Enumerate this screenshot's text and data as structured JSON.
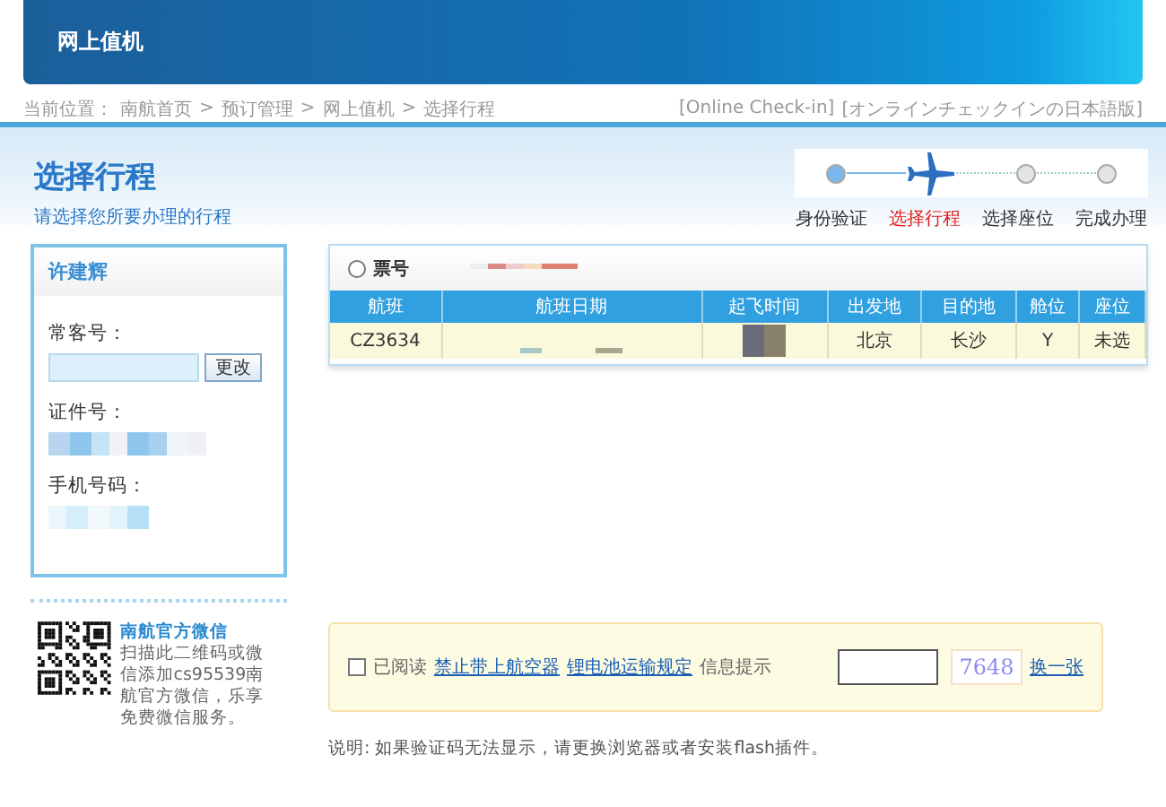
{
  "header": {
    "title": "网上值机"
  },
  "breadcrumb": {
    "label": "当前位置：",
    "separator": ">",
    "items": [
      "南航首页",
      "预订管理",
      "网上值机",
      "选择行程"
    ]
  },
  "language_links": [
    "[Online Check-in]",
    "[オンラインチェックインの日本語版]"
  ],
  "page": {
    "title": "选择行程",
    "subtitle": "请选择您所要办理的行程"
  },
  "steps": [
    {
      "label": "身份验证",
      "done": true,
      "selected": false
    },
    {
      "label": "选择行程",
      "done": false,
      "selected": true
    },
    {
      "label": "选择座位",
      "done": false,
      "selected": false
    },
    {
      "label": "完成办理",
      "done": false,
      "selected": false
    }
  ],
  "passenger": {
    "name": "许建辉",
    "fields": [
      {
        "kind": "input",
        "label": "常客号：",
        "button": "更改"
      },
      {
        "kind": "hidden",
        "label": "证件号："
      },
      {
        "kind": "hidden",
        "label": "手机号码："
      }
    ]
  },
  "ticket": {
    "label": "票号",
    "selected": false
  },
  "table": {
    "columns": [
      "航班",
      "航班日期",
      "起飞时间",
      "出发地",
      "目的地",
      "舱位",
      "座位"
    ],
    "rows": [
      {
        "flight": "CZ3634",
        "origin": "北京",
        "destination": "长沙",
        "cabin": "Y",
        "seat": "未选"
      }
    ]
  },
  "wechat": {
    "title": "南航官方微信",
    "text": "扫描此二维码或微信添加cs95539南航官方微信，乐享免费微信服务。"
  },
  "agreement": {
    "checked": false,
    "label": "已阅读",
    "links": [
      "禁止带上航空器",
      "锂电池运输规定"
    ],
    "hint": "信息提示",
    "captcha": "7648",
    "refresh": "换一张"
  },
  "note": "说明: 如果验证码无法显示，请更换浏览器或者安装flash插件。"
}
